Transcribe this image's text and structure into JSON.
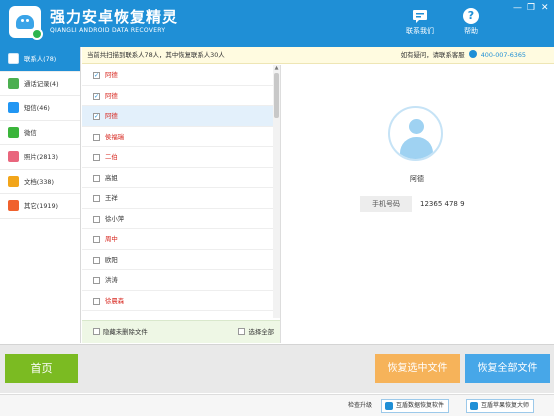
{
  "titlebar": {
    "app_title": "强力安卓恢复精灵",
    "app_subtitle": "QIANGLI ANDROID DATA RECOVERY",
    "contact_us": "联系我们",
    "help": "帮助",
    "help_glyph": "?",
    "minimize_glyph": "—",
    "maximize_glyph": "❐",
    "close_glyph": "✕"
  },
  "sidebar": {
    "items": [
      {
        "label": "联系人(78)",
        "icon": "contacts-icon",
        "color": "#ffffff",
        "active": true
      },
      {
        "label": "通话记录(4)",
        "icon": "call-log-icon",
        "color": "#4caf50"
      },
      {
        "label": "短信(46)",
        "icon": "sms-icon",
        "color": "#2196f3"
      },
      {
        "label": "微信",
        "icon": "wechat-icon",
        "color": "#3bb53b"
      },
      {
        "label": "照片(2813)",
        "icon": "photos-icon",
        "color": "#e9667d"
      },
      {
        "label": "文档(338)",
        "icon": "documents-icon",
        "color": "#f2a51a"
      },
      {
        "label": "其它(1919)",
        "icon": "others-icon",
        "color": "#f0612d"
      }
    ]
  },
  "infobar": {
    "scan_result": "当前共扫描到联系人78人，其中恢复联系人30人",
    "help_prompt": "如有疑问，请联系客服",
    "phone": "400-007-6365"
  },
  "contacts": {
    "rows": [
      {
        "name": "阿德",
        "checked": true,
        "deleted": true,
        "selected": false
      },
      {
        "name": "阿德",
        "checked": true,
        "deleted": true,
        "selected": false
      },
      {
        "name": "阿德",
        "checked": true,
        "deleted": true,
        "selected": true
      },
      {
        "name": "侯福瑞",
        "checked": false,
        "deleted": true,
        "selected": false
      },
      {
        "name": "二伯",
        "checked": false,
        "deleted": true,
        "selected": false
      },
      {
        "name": "高姐",
        "checked": false,
        "deleted": false,
        "selected": false
      },
      {
        "name": "王祥",
        "checked": false,
        "deleted": false,
        "selected": false
      },
      {
        "name": "徐小萍",
        "checked": false,
        "deleted": false,
        "selected": false
      },
      {
        "name": "周中",
        "checked": false,
        "deleted": true,
        "selected": false
      },
      {
        "name": "欧阳",
        "checked": false,
        "deleted": false,
        "selected": false
      },
      {
        "name": "洪涛",
        "checked": false,
        "deleted": false,
        "selected": false
      },
      {
        "name": "徐晨森",
        "checked": false,
        "deleted": true,
        "selected": false
      }
    ],
    "hide_deleted_label": "隐藏未删除文件",
    "select_all_label": "选择全部",
    "check_glyph": "✓"
  },
  "detail": {
    "name": "阿德",
    "phone_label": "手机号码",
    "phone_value": "12365 478 9"
  },
  "actions": {
    "home": "首页",
    "restore_selected": "恢复选中文件",
    "restore_all": "恢复全部文件"
  },
  "statusbar": {
    "check_update": "检查升级",
    "promo1": "互盾数据恢复软件",
    "promo2": "互盾苹果恢复大师"
  },
  "colors": {
    "accent": "#1f8fd6",
    "deleted_text": "#d7261e",
    "home_button": "#7bbb22",
    "restore_selected_button": "#f6b35a",
    "restore_all_button": "#47a7e8"
  }
}
